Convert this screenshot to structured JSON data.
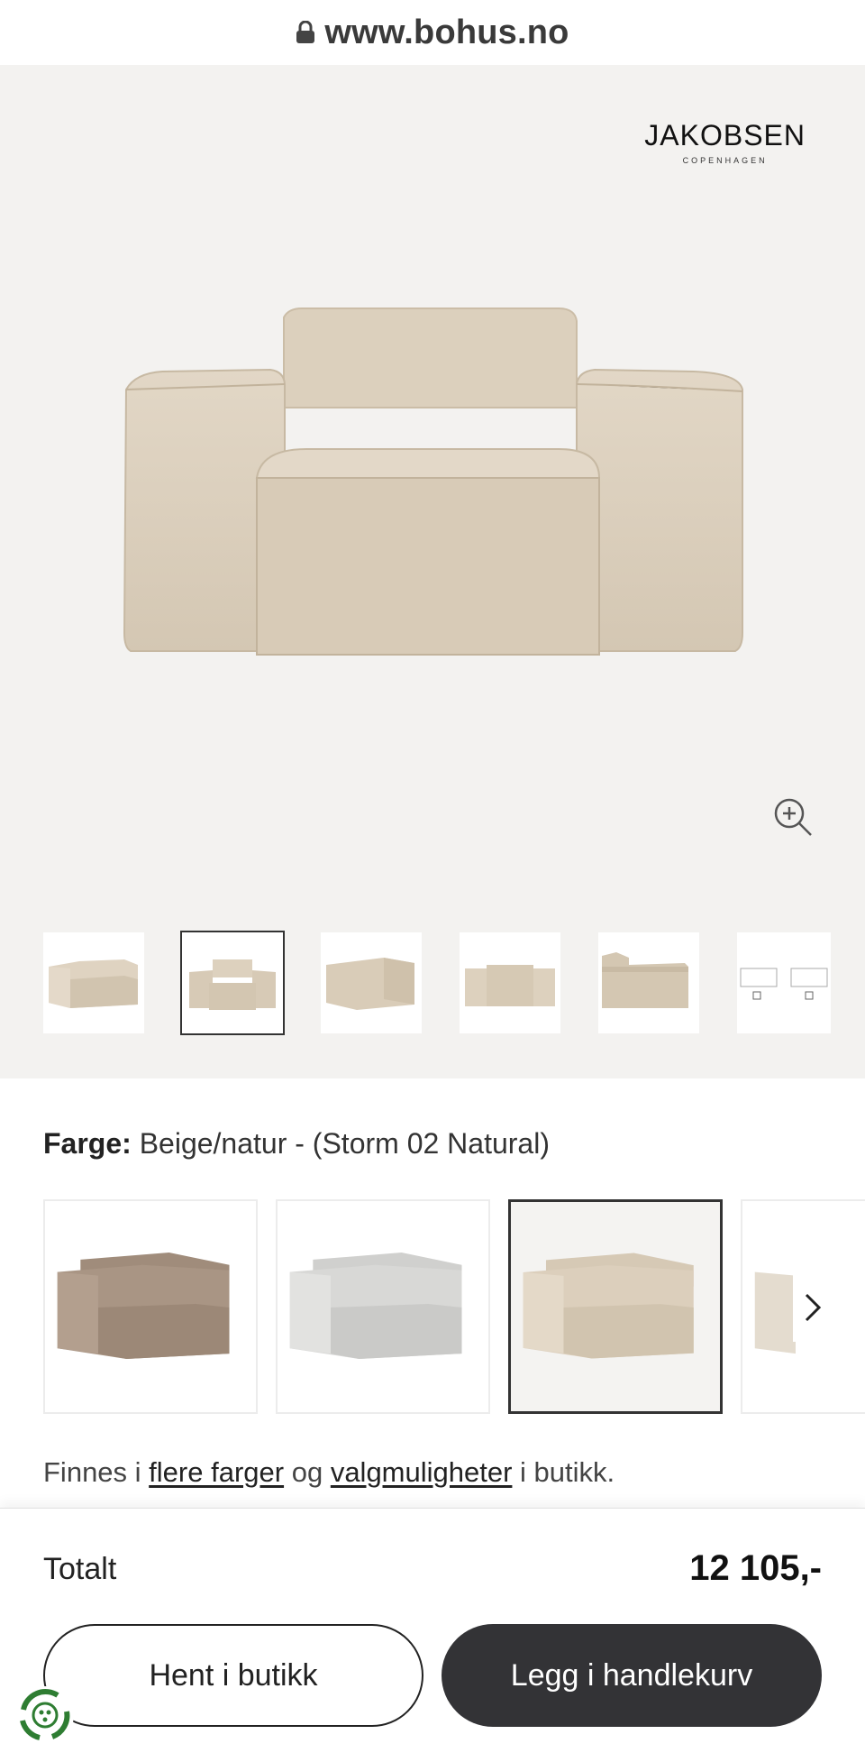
{
  "browser": {
    "url": "www.bohus.no",
    "lock_icon": "lock-icon"
  },
  "brand": {
    "name": "JAKOBSEN",
    "sub": "COPENHAGEN"
  },
  "gallery": {
    "selected_thumb": 2,
    "thumb_count": 6,
    "zoom_icon": "zoom-in-icon"
  },
  "color": {
    "label": "Farge:",
    "value": "Beige/natur - (Storm 02 Natural)"
  },
  "swatches": {
    "selected": 3,
    "next_icon": "chevron-right-icon"
  },
  "availability": {
    "prefix": "Finnes i",
    "link1": "flere farger",
    "mid": "og",
    "link2": "valgmuligheter",
    "suffix": "i butikk."
  },
  "footer": {
    "total_label": "Totalt",
    "total_price": "12 105,-",
    "store_button": "Hent i butikk",
    "cart_button": "Legg i handlekurv"
  },
  "colors": {
    "dark": "#333336",
    "hero_bg": "#f3f2f0",
    "beige": "#d9ccb8",
    "grey": "#d5d5d3",
    "brown": "#a89584"
  }
}
